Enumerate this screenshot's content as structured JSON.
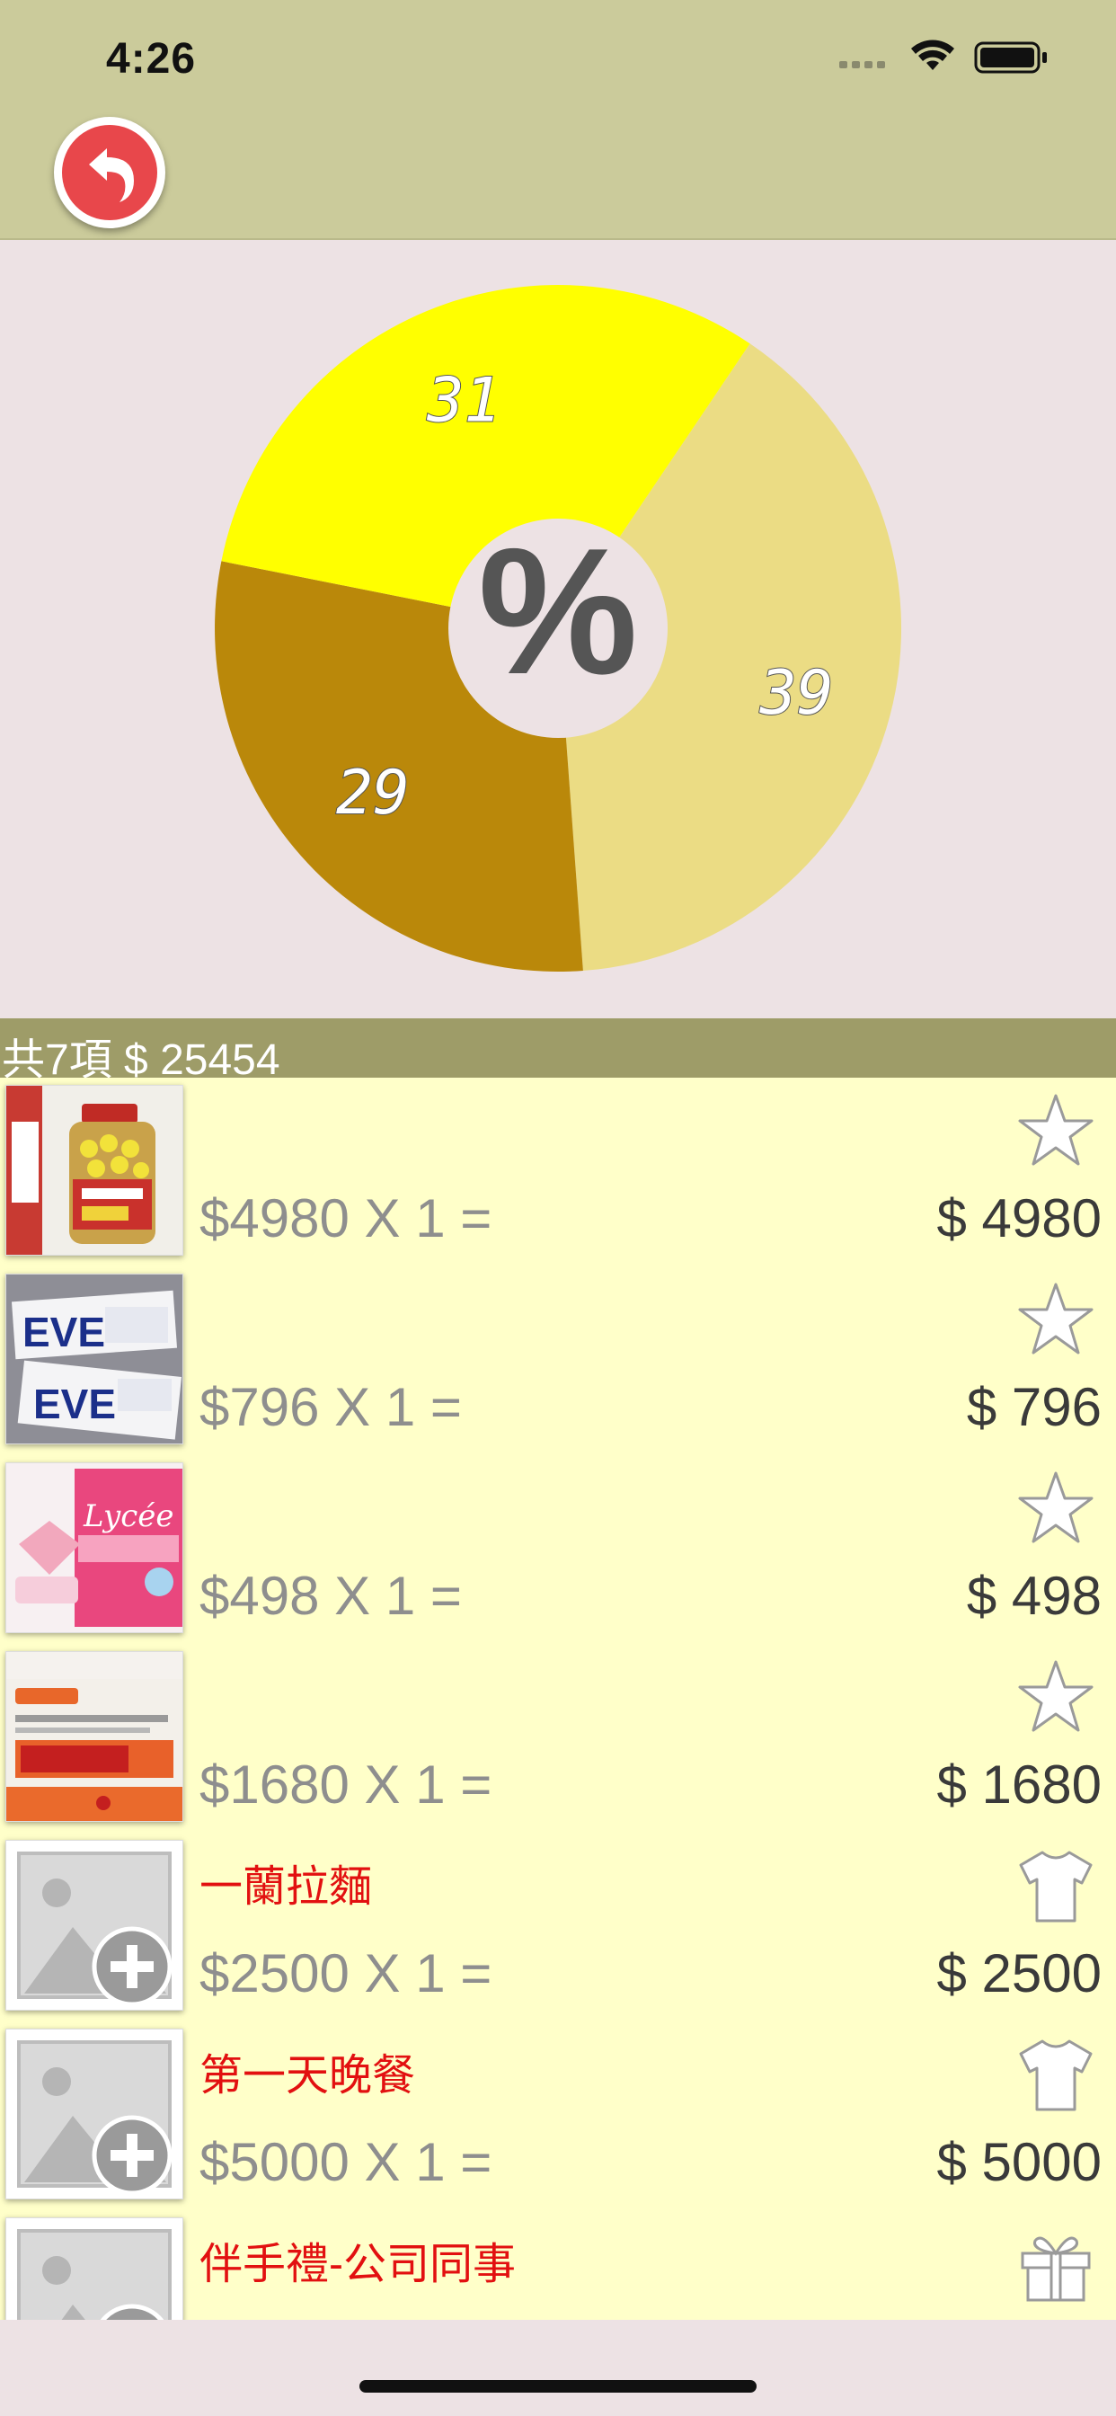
{
  "status_bar": {
    "time": "4:26"
  },
  "header": {
    "back_button_icon": "undo-arrow-icon"
  },
  "chart_data": {
    "type": "pie",
    "title": "",
    "center_label": "%",
    "donut": true,
    "slices": [
      {
        "value": 39,
        "label": "39",
        "color": "#ebdc84"
      },
      {
        "value": 29,
        "label": "29",
        "color": "#ba880a"
      },
      {
        "value": 31,
        "label": "31",
        "color": "#ffff00"
      }
    ],
    "start_angle_deg": -56
  },
  "summary": {
    "text": "共7項 $ 25454"
  },
  "items": [
    {
      "title": "",
      "formula": "$4980 X 1 =",
      "total": "$ 4980",
      "icon": "star-icon",
      "thumb": "photo-medicine-bottle"
    },
    {
      "title": "",
      "formula": "$796 X 1 =",
      "total": "$ 796",
      "icon": "star-icon",
      "thumb": "photo-eve-box"
    },
    {
      "title": "",
      "formula": "$498 X 1 =",
      "total": "$ 498",
      "icon": "star-icon",
      "thumb": "photo-lycee-box"
    },
    {
      "title": "",
      "formula": "$1680 X 1 =",
      "total": "$ 1680",
      "icon": "star-icon",
      "thumb": "photo-lulu-box"
    },
    {
      "title": "一蘭拉麵",
      "formula": "$2500 X 1 =",
      "total": "$ 2500",
      "icon": "shirt-icon",
      "thumb": "placeholder-add-photo"
    },
    {
      "title": "第一天晚餐",
      "formula": "$5000 X 1 =",
      "total": "$ 5000",
      "icon": "shirt-icon",
      "thumb": "placeholder-add-photo"
    },
    {
      "title": "伴手禮-公司同事",
      "formula": "",
      "total": "",
      "icon": "gift-icon",
      "thumb": "placeholder-add-photo"
    }
  ],
  "colors": {
    "header": "#cbcb9b",
    "summary": "#9e9c68",
    "list": "#ffffc9",
    "background": "#ede2e4",
    "item_title": "#e21010"
  }
}
